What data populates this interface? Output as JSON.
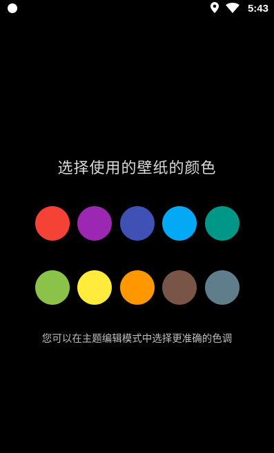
{
  "status_bar": {
    "time": "5:43",
    "icons": [
      "notification-dot-icon",
      "location-pin-icon",
      "wifi-icon"
    ]
  },
  "title": "选择使用的壁纸的颜色",
  "swatches": {
    "row1": [
      {
        "name": "red",
        "color": "#F44336"
      },
      {
        "name": "purple",
        "color": "#9C27B0"
      },
      {
        "name": "indigo",
        "color": "#3F51B5"
      },
      {
        "name": "light-blue",
        "color": "#03A9F4"
      },
      {
        "name": "teal",
        "color": "#009688"
      }
    ],
    "row2": [
      {
        "name": "light-green",
        "color": "#8BC34A"
      },
      {
        "name": "yellow",
        "color": "#FFEB3B"
      },
      {
        "name": "orange",
        "color": "#FF9800"
      },
      {
        "name": "brown",
        "color": "#795548"
      },
      {
        "name": "blue-grey",
        "color": "#607D8B"
      }
    ]
  },
  "hint": "您可以在主题编辑模式中选择更准确的色调"
}
